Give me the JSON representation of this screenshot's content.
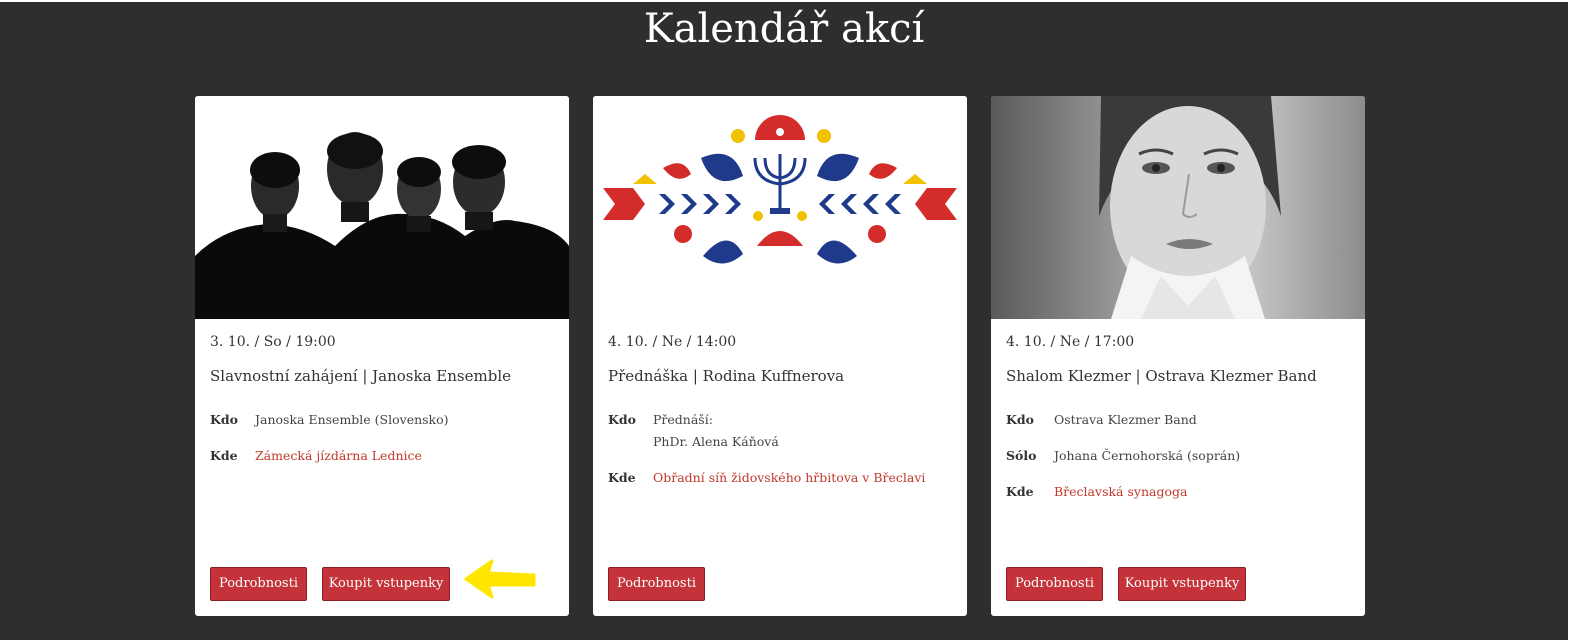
{
  "page": {
    "title": "Kalendář akcí"
  },
  "colors": {
    "background": "#2e2e2e",
    "accent": "#c4323a",
    "link": "#c0392b",
    "annotation": "#ffe600"
  },
  "events": [
    {
      "date": "3. 10. / So / 19:00",
      "title": "Slavnostní zahájení | Janoska Ensemble",
      "rows": [
        {
          "label": "Kdo",
          "value": "Janoska Ensemble (Slovensko)"
        },
        {
          "label": "Kde",
          "value": "Zámecká jízdárna Lednice"
        }
      ],
      "buttons": {
        "details": "Podrobnosti",
        "buy": "Koupit vstupenky"
      }
    },
    {
      "date": "4. 10. / Ne / 14:00",
      "title": "Přednáška | Rodina Kuffnerova",
      "rows": [
        {
          "label": "Kdo",
          "value": "Přednáší:\nPhDr. Alena Káňová"
        },
        {
          "label": "Kde",
          "value": "Obřadní síň židovského hřbitova v Břeclavi"
        }
      ],
      "buttons": {
        "details": "Podrobnosti"
      }
    },
    {
      "date": "4. 10. / Ne / 17:00",
      "title": "Shalom Klezmer | Ostrava Klezmer Band",
      "rows": [
        {
          "label": "Kdo",
          "value": "Ostrava Klezmer Band"
        },
        {
          "label": "Sólo",
          "value": "Johana Černohorská (soprán)"
        },
        {
          "label": "Kde",
          "value": "Břeclavská synagoga"
        }
      ],
      "buttons": {
        "details": "Podrobnosti",
        "buy": "Koupit vstupenky"
      }
    }
  ]
}
